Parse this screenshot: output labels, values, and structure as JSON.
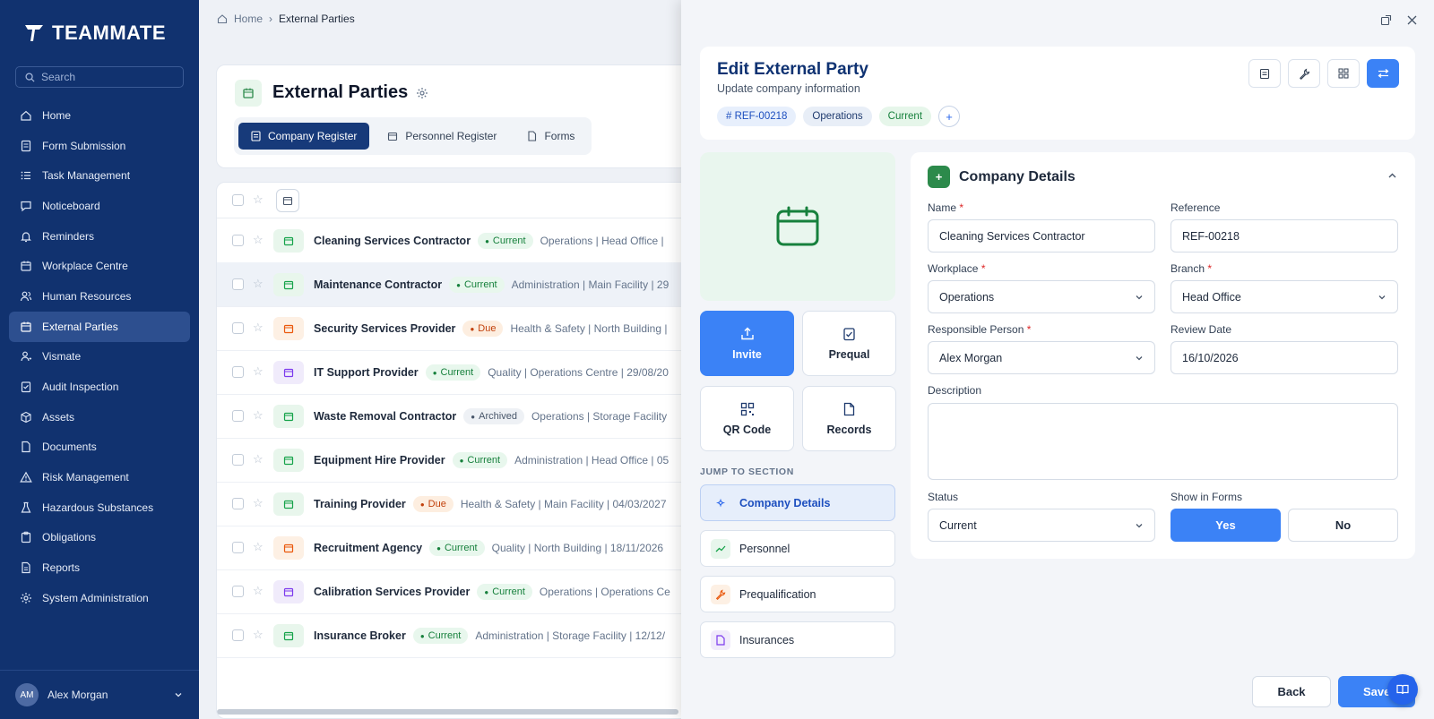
{
  "app": {
    "name": "TEAMMATE"
  },
  "sidebar": {
    "search_placeholder": "Search",
    "items": [
      {
        "label": "Home",
        "icon": "home-icon"
      },
      {
        "label": "Form Submission",
        "icon": "form-icon"
      },
      {
        "label": "Task Management",
        "icon": "task-icon"
      },
      {
        "label": "Noticeboard",
        "icon": "noticeboard-icon"
      },
      {
        "label": "Reminders",
        "icon": "bell-icon"
      },
      {
        "label": "Workplace Centre",
        "icon": "building-icon"
      },
      {
        "label": "Human Resources",
        "icon": "people-icon"
      },
      {
        "label": "External Parties",
        "icon": "calendar-icon",
        "active": true
      },
      {
        "label": "Vismate",
        "icon": "visitor-icon"
      },
      {
        "label": "Audit Inspection",
        "icon": "audit-icon"
      },
      {
        "label": "Assets",
        "icon": "box-icon"
      },
      {
        "label": "Documents",
        "icon": "document-icon"
      },
      {
        "label": "Risk Management",
        "icon": "warning-icon"
      },
      {
        "label": "Hazardous Substances",
        "icon": "flask-icon"
      },
      {
        "label": "Obligations",
        "icon": "clipboard-icon"
      },
      {
        "label": "Reports",
        "icon": "report-icon"
      },
      {
        "label": "System Administration",
        "icon": "gear-icon"
      }
    ],
    "user": {
      "initials": "AM",
      "name": "Alex Morgan"
    }
  },
  "breadcrumb": {
    "home": "Home",
    "current": "External Parties"
  },
  "page": {
    "title": "External Parties",
    "tabs": [
      "Company Register",
      "Personnel Register",
      "Forms"
    ]
  },
  "rows": [
    {
      "name": "Cleaning Services Contractor",
      "status": "Current",
      "meta": "Operations | Head Office |",
      "tone": "green"
    },
    {
      "name": "Maintenance Contractor",
      "status": "Current",
      "meta": "Administration | Main Facility | 29",
      "tone": "green",
      "selected": true
    },
    {
      "name": "Security Services Provider",
      "status": "Due",
      "meta": "Health & Safety | North Building |",
      "tone": "orange"
    },
    {
      "name": "IT Support Provider",
      "status": "Current",
      "meta": "Quality | Operations Centre | 29/08/20",
      "tone": "purple"
    },
    {
      "name": "Waste Removal Contractor",
      "status": "Archived",
      "meta": "Operations | Storage Facility",
      "tone": "green"
    },
    {
      "name": "Equipment Hire Provider",
      "status": "Current",
      "meta": "Administration | Head Office | 05",
      "tone": "green"
    },
    {
      "name": "Training Provider",
      "status": "Due",
      "meta": "Health & Safety | Main Facility | 04/03/2027",
      "tone": "green"
    },
    {
      "name": "Recruitment Agency",
      "status": "Current",
      "meta": "Quality | North Building | 18/11/2026",
      "tone": "orange"
    },
    {
      "name": "Calibration Services Provider",
      "status": "Current",
      "meta": "Operations | Operations Ce",
      "tone": "purple"
    },
    {
      "name": "Insurance Broker",
      "status": "Current",
      "meta": "Administration | Storage Facility | 12/12/",
      "tone": "green"
    }
  ],
  "edit": {
    "title": "Edit External Party",
    "subtitle": "Update company information",
    "tags": [
      "# REF-00218",
      "Operations",
      "Current"
    ],
    "tag_add": "+",
    "actions": [
      "Invite",
      "Prequal",
      "QR Code",
      "Records"
    ],
    "jump_label": "JUMP TO SECTION",
    "sections": [
      "Company Details",
      "Personnel",
      "Prequalification",
      "Insurances"
    ],
    "card_title": "Company Details",
    "fields": {
      "name": {
        "label": "Name",
        "value": "Cleaning Services Contractor"
      },
      "reference": {
        "label": "Reference",
        "value": "REF-00218"
      },
      "workplace": {
        "label": "Workplace",
        "value": "Operations"
      },
      "branch": {
        "label": "Branch",
        "value": "Head Office"
      },
      "responsible": {
        "label": "Responsible Person",
        "value": "Alex Morgan"
      },
      "review_date": {
        "label": "Review Date",
        "value": "16/10/2026"
      },
      "description": {
        "label": "Description",
        "value": ""
      },
      "status": {
        "label": "Status",
        "value": "Current"
      },
      "show_in_forms": {
        "label": "Show in Forms",
        "yes": "Yes",
        "no": "No",
        "selected": "Yes"
      }
    },
    "back_label": "Back",
    "save_label": "Save"
  },
  "colors": {
    "sidebar": "#11326f",
    "accent": "#3b82f6",
    "green": "#16a34a",
    "orange": "#ea580c"
  }
}
